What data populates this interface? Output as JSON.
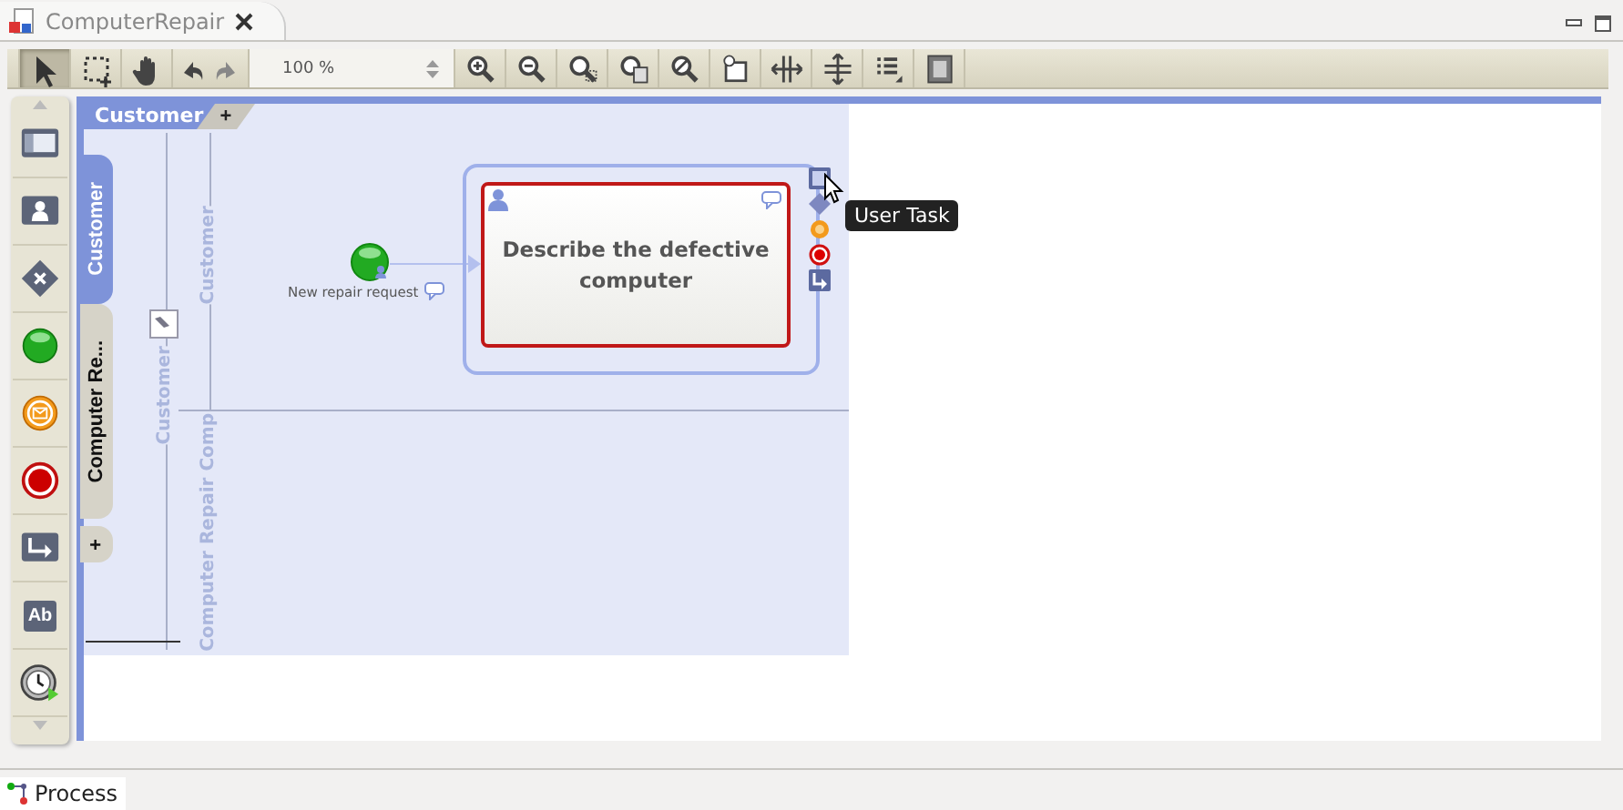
{
  "editor_tab": {
    "title": "ComputerRepair",
    "selected": true
  },
  "toolbar": {
    "tools": [
      {
        "kind": "select",
        "selected": true
      },
      {
        "kind": "marquee",
        "selected": false
      },
      {
        "kind": "hand",
        "selected": false
      },
      {
        "kind": "undo-redo",
        "selected": false
      }
    ],
    "zoom": "100 %",
    "actions": [
      {
        "kind": "zoom-in"
      },
      {
        "kind": "zoom-out"
      },
      {
        "kind": "zoom-fit"
      },
      {
        "kind": "zoom-page"
      },
      {
        "kind": "zoom-reset"
      },
      {
        "kind": "page"
      },
      {
        "kind": "h-spread"
      },
      {
        "kind": "v-spread"
      },
      {
        "kind": "list"
      },
      {
        "kind": "film"
      }
    ]
  },
  "palette": [
    {
      "kind": "pool"
    },
    {
      "kind": "lane"
    },
    {
      "kind": "gateway"
    },
    {
      "kind": "start"
    },
    {
      "kind": "message"
    },
    {
      "kind": "end"
    },
    {
      "kind": "flow"
    },
    {
      "kind": "text",
      "label": "Ab"
    },
    {
      "kind": "timer"
    }
  ],
  "pool": {
    "title": "Customer",
    "add_label": "+"
  },
  "participant_tabs": [
    {
      "label": "Customer",
      "selected": true
    },
    {
      "label": "Computer Re...",
      "selected": false
    }
  ],
  "add_tab": "+",
  "lanes": {
    "outer_label": "Customer",
    "inner_label": "Customer",
    "lower_label": "Computer Repair Comp"
  },
  "start_event": {
    "label": "New repair request"
  },
  "task": {
    "label": "Describe the defective computer",
    "selected": true
  },
  "tooltip": "User Task",
  "bottom_tabs": [
    {
      "label": "Process",
      "selected": true
    }
  ]
}
